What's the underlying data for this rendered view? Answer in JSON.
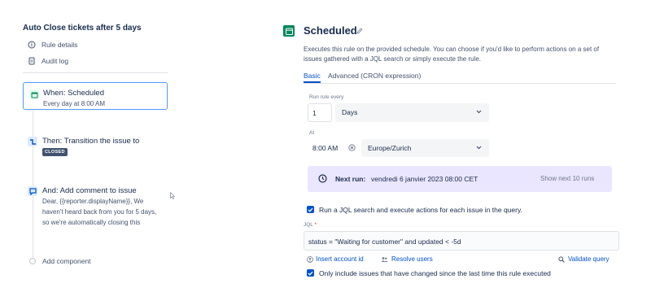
{
  "sidebar": {
    "rule_title": "Auto Close tickets after 5 days",
    "links": [
      {
        "label": "Rule details",
        "icon": "info-icon"
      },
      {
        "label": "Audit log",
        "icon": "document-icon"
      }
    ],
    "trigger": {
      "title": "When: Scheduled",
      "subtitle": "Every day at 8:00 AM",
      "icon": "calendar-icon"
    },
    "action_transition": {
      "title": "Then: Transition the issue to",
      "badge": "CLOSED",
      "icon": "transition-icon"
    },
    "action_comment": {
      "title": "And: Add comment to issue",
      "lines": [
        "Dear, {{reporter.displayName}}, We",
        "haven't heard back from you for 5 days,",
        "so we're automatically closing this"
      ],
      "icon": "comment-icon"
    },
    "add_component": "Add component"
  },
  "main": {
    "title": "Scheduled",
    "description": [
      "Executes this rule on the provided schedule. You can choose if you'd like to perform actions on a set of",
      "issues gathered with a JQL search or simply execute the rule."
    ],
    "tabs": [
      "Basic",
      "Advanced (CRON expression)"
    ],
    "active_tab": "Basic",
    "rule_every_label": "Run rule every",
    "every_value": "1",
    "every_unit": "Days",
    "at_label": "At",
    "time_value": "8:00 AM",
    "timezone": "Europe/Zurich",
    "next_run_label": "Next run:",
    "next_run_value": "vendredi 6 janvier 2023 08:00 CET",
    "show_next_runs": "Show next 10 runs",
    "jql_checkbox_label": "Run a JQL search and execute actions for each issue in the query.",
    "jql_label": "JQL",
    "jql_required": "*",
    "jql_value": "status = \"Waiting for customer\" and updated < -5d",
    "insert_account": "Insert account id",
    "resolve_users": "Resolve users",
    "validate_query": "Validate query",
    "changed_checkbox_label": "Only include issues that have changed since the last time this rule executed"
  },
  "colors": {
    "accent": "#0052cc",
    "selected_border": "#4c9aff",
    "scheduled_green": "#00875a",
    "next_run_bg": "#eae6ff",
    "badge_bg": "#42526e"
  }
}
